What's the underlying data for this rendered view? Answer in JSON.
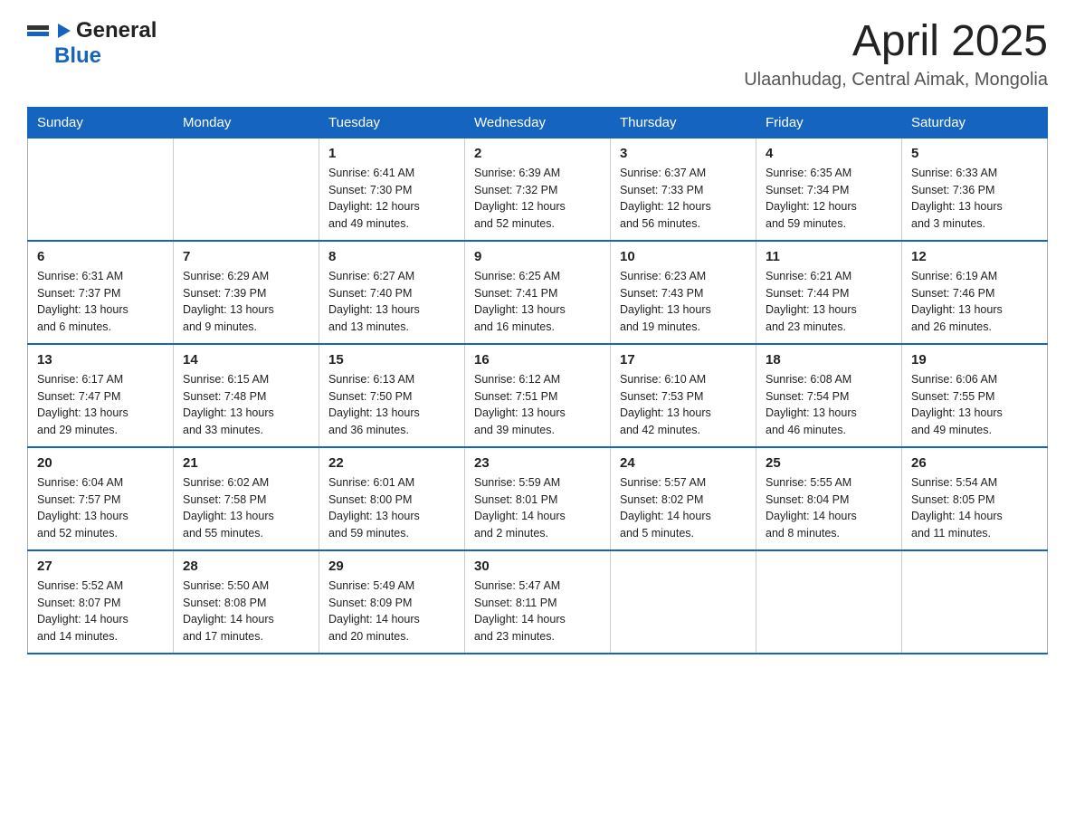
{
  "header": {
    "logo_general": "General",
    "logo_blue": "Blue",
    "title": "April 2025",
    "location": "Ulaanhudag, Central Aimak, Mongolia"
  },
  "calendar": {
    "days_of_week": [
      "Sunday",
      "Monday",
      "Tuesday",
      "Wednesday",
      "Thursday",
      "Friday",
      "Saturday"
    ],
    "weeks": [
      [
        {
          "day": "",
          "info": ""
        },
        {
          "day": "",
          "info": ""
        },
        {
          "day": "1",
          "info": "Sunrise: 6:41 AM\nSunset: 7:30 PM\nDaylight: 12 hours\nand 49 minutes."
        },
        {
          "day": "2",
          "info": "Sunrise: 6:39 AM\nSunset: 7:32 PM\nDaylight: 12 hours\nand 52 minutes."
        },
        {
          "day": "3",
          "info": "Sunrise: 6:37 AM\nSunset: 7:33 PM\nDaylight: 12 hours\nand 56 minutes."
        },
        {
          "day": "4",
          "info": "Sunrise: 6:35 AM\nSunset: 7:34 PM\nDaylight: 12 hours\nand 59 minutes."
        },
        {
          "day": "5",
          "info": "Sunrise: 6:33 AM\nSunset: 7:36 PM\nDaylight: 13 hours\nand 3 minutes."
        }
      ],
      [
        {
          "day": "6",
          "info": "Sunrise: 6:31 AM\nSunset: 7:37 PM\nDaylight: 13 hours\nand 6 minutes."
        },
        {
          "day": "7",
          "info": "Sunrise: 6:29 AM\nSunset: 7:39 PM\nDaylight: 13 hours\nand 9 minutes."
        },
        {
          "day": "8",
          "info": "Sunrise: 6:27 AM\nSunset: 7:40 PM\nDaylight: 13 hours\nand 13 minutes."
        },
        {
          "day": "9",
          "info": "Sunrise: 6:25 AM\nSunset: 7:41 PM\nDaylight: 13 hours\nand 16 minutes."
        },
        {
          "day": "10",
          "info": "Sunrise: 6:23 AM\nSunset: 7:43 PM\nDaylight: 13 hours\nand 19 minutes."
        },
        {
          "day": "11",
          "info": "Sunrise: 6:21 AM\nSunset: 7:44 PM\nDaylight: 13 hours\nand 23 minutes."
        },
        {
          "day": "12",
          "info": "Sunrise: 6:19 AM\nSunset: 7:46 PM\nDaylight: 13 hours\nand 26 minutes."
        }
      ],
      [
        {
          "day": "13",
          "info": "Sunrise: 6:17 AM\nSunset: 7:47 PM\nDaylight: 13 hours\nand 29 minutes."
        },
        {
          "day": "14",
          "info": "Sunrise: 6:15 AM\nSunset: 7:48 PM\nDaylight: 13 hours\nand 33 minutes."
        },
        {
          "day": "15",
          "info": "Sunrise: 6:13 AM\nSunset: 7:50 PM\nDaylight: 13 hours\nand 36 minutes."
        },
        {
          "day": "16",
          "info": "Sunrise: 6:12 AM\nSunset: 7:51 PM\nDaylight: 13 hours\nand 39 minutes."
        },
        {
          "day": "17",
          "info": "Sunrise: 6:10 AM\nSunset: 7:53 PM\nDaylight: 13 hours\nand 42 minutes."
        },
        {
          "day": "18",
          "info": "Sunrise: 6:08 AM\nSunset: 7:54 PM\nDaylight: 13 hours\nand 46 minutes."
        },
        {
          "day": "19",
          "info": "Sunrise: 6:06 AM\nSunset: 7:55 PM\nDaylight: 13 hours\nand 49 minutes."
        }
      ],
      [
        {
          "day": "20",
          "info": "Sunrise: 6:04 AM\nSunset: 7:57 PM\nDaylight: 13 hours\nand 52 minutes."
        },
        {
          "day": "21",
          "info": "Sunrise: 6:02 AM\nSunset: 7:58 PM\nDaylight: 13 hours\nand 55 minutes."
        },
        {
          "day": "22",
          "info": "Sunrise: 6:01 AM\nSunset: 8:00 PM\nDaylight: 13 hours\nand 59 minutes."
        },
        {
          "day": "23",
          "info": "Sunrise: 5:59 AM\nSunset: 8:01 PM\nDaylight: 14 hours\nand 2 minutes."
        },
        {
          "day": "24",
          "info": "Sunrise: 5:57 AM\nSunset: 8:02 PM\nDaylight: 14 hours\nand 5 minutes."
        },
        {
          "day": "25",
          "info": "Sunrise: 5:55 AM\nSunset: 8:04 PM\nDaylight: 14 hours\nand 8 minutes."
        },
        {
          "day": "26",
          "info": "Sunrise: 5:54 AM\nSunset: 8:05 PM\nDaylight: 14 hours\nand 11 minutes."
        }
      ],
      [
        {
          "day": "27",
          "info": "Sunrise: 5:52 AM\nSunset: 8:07 PM\nDaylight: 14 hours\nand 14 minutes."
        },
        {
          "day": "28",
          "info": "Sunrise: 5:50 AM\nSunset: 8:08 PM\nDaylight: 14 hours\nand 17 minutes."
        },
        {
          "day": "29",
          "info": "Sunrise: 5:49 AM\nSunset: 8:09 PM\nDaylight: 14 hours\nand 20 minutes."
        },
        {
          "day": "30",
          "info": "Sunrise: 5:47 AM\nSunset: 8:11 PM\nDaylight: 14 hours\nand 23 minutes."
        },
        {
          "day": "",
          "info": ""
        },
        {
          "day": "",
          "info": ""
        },
        {
          "day": "",
          "info": ""
        }
      ]
    ]
  }
}
